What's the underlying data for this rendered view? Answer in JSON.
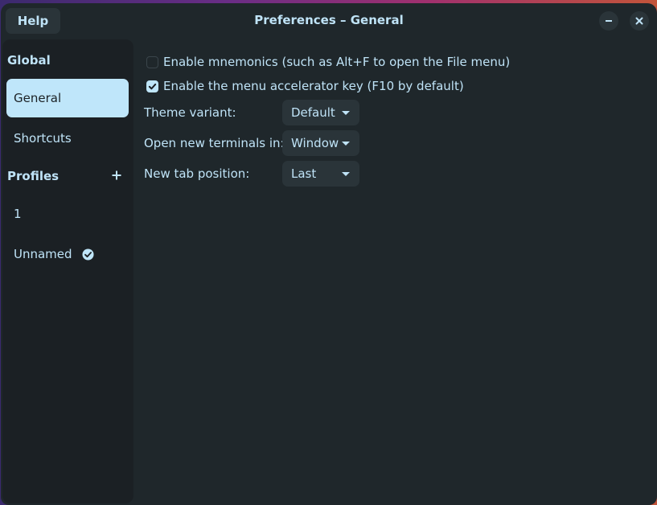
{
  "window": {
    "title": "Preferences – General"
  },
  "titlebar": {
    "help_label": "Help",
    "minimize_icon": "minimize-icon",
    "close_icon": "close-icon"
  },
  "sidebar": {
    "global_heading": "Global",
    "global_items": [
      {
        "label": "General",
        "selected": true
      },
      {
        "label": "Shortcuts",
        "selected": false
      }
    ],
    "profiles_heading": "Profiles",
    "add_profile_icon": "plus-icon",
    "profiles": [
      {
        "label": "1",
        "default": false
      },
      {
        "label": "Unnamed",
        "default": true,
        "badge_icon": "check-circle-icon"
      }
    ]
  },
  "general": {
    "checkboxes": [
      {
        "label": "Enable mnemonics (such as Alt+F to open the File menu)",
        "checked": false
      },
      {
        "label": "Enable the menu accelerator key (F10 by default)",
        "checked": true
      }
    ],
    "settings": [
      {
        "label": "Theme variant:",
        "value": "Default"
      },
      {
        "label": "Open new terminals in:",
        "value": "Window"
      },
      {
        "label": "New tab position:",
        "value": "Last"
      }
    ]
  },
  "colors": {
    "accent": "#bfe6fa",
    "window_bg": "#1f272b",
    "sidebar_bg": "#1b2024",
    "button_bg": "#2a3439",
    "text": "#bfe3f7"
  }
}
